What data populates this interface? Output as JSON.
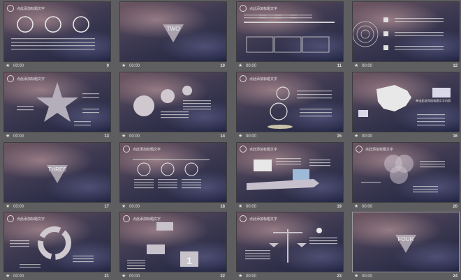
{
  "slides": [
    {
      "index": "9",
      "time": "00:00",
      "title": "点此添加标题文字",
      "kind": "circles"
    },
    {
      "index": "10",
      "time": "00:00",
      "title": "",
      "kind": "triangle",
      "label": "TWO"
    },
    {
      "index": "11",
      "time": "00:00",
      "title": "点此添加标题文字",
      "kind": "timeline"
    },
    {
      "index": "12",
      "time": "00:00",
      "title": "",
      "kind": "radial"
    },
    {
      "index": "13",
      "time": "00:00",
      "title": "点此添加标题文字",
      "kind": "star"
    },
    {
      "index": "14",
      "time": "00:00",
      "title": "",
      "kind": "bubbles"
    },
    {
      "index": "15",
      "time": "00:00",
      "title": "点此添加标题文字",
      "kind": "pedestal"
    },
    {
      "index": "16",
      "time": "00:00",
      "title": "",
      "kind": "map",
      "caption": "单击此处添加标题文字内容"
    },
    {
      "index": "17",
      "time": "00:00",
      "title": "",
      "kind": "triangle",
      "label": "THREE"
    },
    {
      "index": "18",
      "time": "00:00",
      "title": "点此添加标题文字",
      "kind": "icons3"
    },
    {
      "index": "19",
      "time": "00:00",
      "title": "点此添加标题文字",
      "kind": "arrow"
    },
    {
      "index": "20",
      "time": "00:00",
      "title": "点此添加标题文字",
      "kind": "venn"
    },
    {
      "index": "21",
      "time": "00:00",
      "title": "点此添加标题文字",
      "kind": "cycle"
    },
    {
      "index": "22",
      "time": "00:00",
      "title": "点此添加标题文字",
      "kind": "flow",
      "big": "1"
    },
    {
      "index": "23",
      "time": "00:00",
      "title": "点此添加标题文字",
      "kind": "scale"
    },
    {
      "index": "24",
      "time": "00:00",
      "title": "",
      "kind": "triangle",
      "label": "FOUR"
    }
  ],
  "colors": {
    "background": "#5e5e60",
    "text": "#e0e0e0"
  },
  "icons": {
    "slide_marker": "star-icon"
  }
}
